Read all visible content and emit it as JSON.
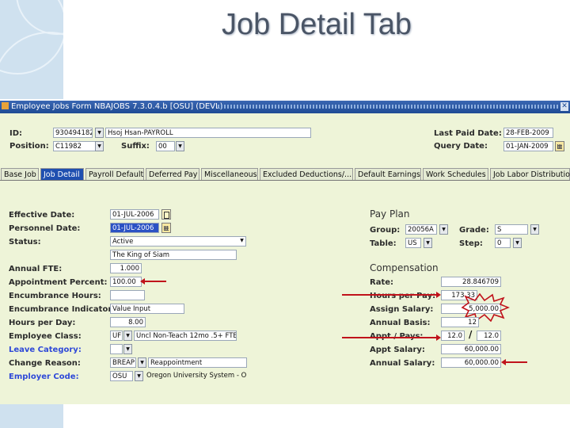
{
  "slide": {
    "title": "Job Detail Tab"
  },
  "window": {
    "title": "Employee Jobs Form  NBAJOBS  7.3.0.4.b  [OSU]  (DEVL)",
    "close_glyph": "✕"
  },
  "header": {
    "id_label": "ID:",
    "id_value": "930494182",
    "name_value": "Hsoj Hsan-PAYROLL",
    "position_label": "Position:",
    "position_value": "C11982",
    "suffix_label": "Suffix:",
    "suffix_value": "00",
    "last_paid_label": "Last Paid Date:",
    "last_paid_value": "28-FEB-2009",
    "query_date_label": "Query Date:",
    "query_date_value": "01-JAN-2009"
  },
  "tabs": [
    {
      "label": "Base Job"
    },
    {
      "label": "Job Detail"
    },
    {
      "label": "Payroll Default"
    },
    {
      "label": "Deferred Pay"
    },
    {
      "label": "Miscellaneous"
    },
    {
      "label": "Excluded Deductions/..."
    },
    {
      "label": "Default Earnings"
    },
    {
      "label": "Work Schedules"
    },
    {
      "label": "Job Labor Distribution"
    }
  ],
  "left": {
    "effective_date": {
      "label": "Effective Date:",
      "value": "01-JUL-2006"
    },
    "personnel_date": {
      "label": "Personnel Date:",
      "value": "01-JUL-2006"
    },
    "status": {
      "label": "Status:",
      "value": "Active"
    },
    "status_desc": "The King of Siam",
    "annual_fte": {
      "label": "Annual FTE:",
      "value": "1.000"
    },
    "appointment_percent": {
      "label": "Appointment Percent:",
      "value": "100.00"
    },
    "encumbrance_hours": {
      "label": "Encumbrance Hours:",
      "value": ""
    },
    "encumbrance_indicator": {
      "label": "Encumbrance Indicator:",
      "value": "Value Input"
    },
    "hours_per_day": {
      "label": "Hours per Day:",
      "value": "8.00"
    },
    "employee_class": {
      "label": "Employee Class:",
      "code": "UF",
      "desc": "Uncl Non-Teach 12mo .5+ FTE"
    },
    "leave_category": {
      "label": "Leave Category:",
      "value": ""
    },
    "change_reason": {
      "label": "Change Reason:",
      "code": "BREAP",
      "desc": "Reappointment"
    },
    "employer_code": {
      "label": "Employer Code:",
      "code": "OSU",
      "desc": "Oregon University System - O"
    }
  },
  "payplan": {
    "title": "Pay Plan",
    "group_label": "Group:",
    "group_value": "20056A",
    "grade_label": "Grade:",
    "grade_value": "S",
    "table_label": "Table:",
    "table_value": "US",
    "step_label": "Step:",
    "step_value": "0"
  },
  "compensation": {
    "title": "Compensation",
    "rate_label": "Rate:",
    "rate_value": "28.846709",
    "hours_per_pay_label": "Hours per Pay:",
    "hours_per_pay_value": "173.33",
    "assign_salary_label": "Assign Salary:",
    "assign_salary_value": "5,000.00",
    "annual_basis_label": "Annual Basis:",
    "annual_basis_value": "12",
    "appt_pays_label": "Appt / Pays:",
    "appt_value": "12.0",
    "pays_value": "12.0",
    "slash": "/",
    "appt_salary_label": "Appt Salary:",
    "appt_salary_value": "60,000.00",
    "annual_salary_label": "Annual Salary:",
    "annual_salary_value": "60,000.00"
  },
  "colors": {
    "form_bg": "#eef4d8",
    "title_bar": "#2a59a8",
    "active_tab": "#1f4fb0",
    "annotation_red": "#c0121b",
    "label_blue": "#2f49d8"
  },
  "icons": {
    "dropdown": "▼",
    "calendar": "calendar-icon",
    "document": "document-icon"
  }
}
